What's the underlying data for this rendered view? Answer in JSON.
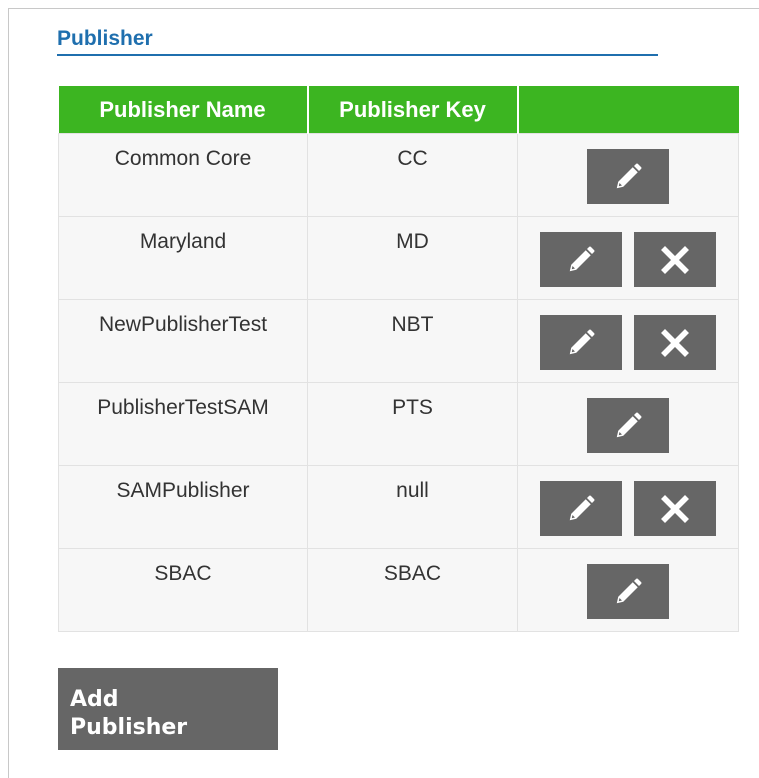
{
  "section": {
    "title": "Publisher"
  },
  "table": {
    "headers": [
      "Publisher Name",
      "Publisher Key",
      ""
    ],
    "rows": [
      {
        "name": "Common Core",
        "key": "CC",
        "can_delete": false
      },
      {
        "name": "Maryland",
        "key": "MD",
        "can_delete": true
      },
      {
        "name": "NewPublisherTest",
        "key": "NBT",
        "can_delete": true
      },
      {
        "name": "PublisherTestSAM",
        "key": "PTS",
        "can_delete": false
      },
      {
        "name": "SAMPublisher",
        "key": "null",
        "can_delete": true
      },
      {
        "name": "SBAC",
        "key": "SBAC",
        "can_delete": false
      }
    ]
  },
  "actions": {
    "add_line1": "Add",
    "add_line2": "Publisher"
  },
  "icons": {
    "edit": "pencil-icon",
    "delete": "close-icon"
  },
  "colors": {
    "title": "#1f6fae",
    "header_bg": "#3cb521",
    "button_bg": "#666666",
    "row_bg": "#f7f7f7"
  }
}
